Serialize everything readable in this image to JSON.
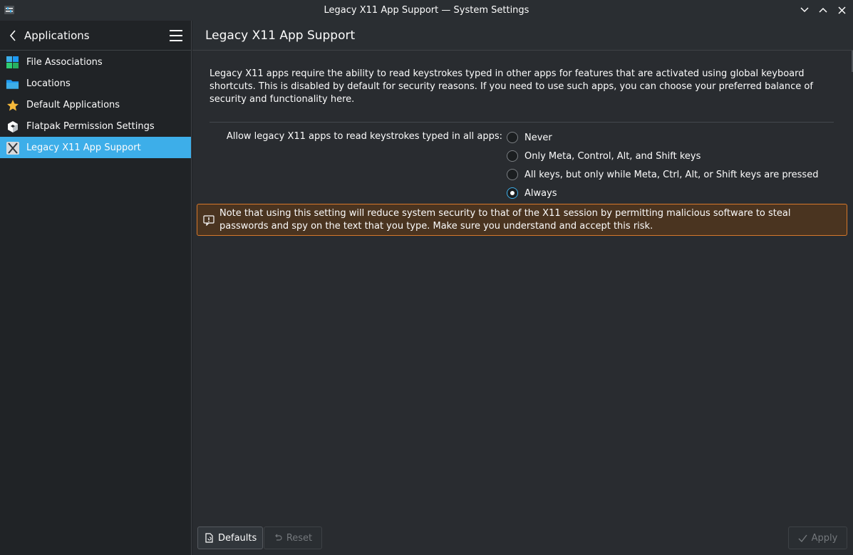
{
  "window": {
    "title": "Legacy X11 App Support — System Settings"
  },
  "sidebar": {
    "header": "Applications",
    "items": [
      {
        "label": "File Associations",
        "icon": "file-associations-icon"
      },
      {
        "label": "Locations",
        "icon": "folder-icon"
      },
      {
        "label": "Default Applications",
        "icon": "star-icon"
      },
      {
        "label": "Flatpak Permission Settings",
        "icon": "flatpak-icon"
      },
      {
        "label": "Legacy X11 App Support",
        "icon": "x11-icon",
        "active": true
      }
    ]
  },
  "main": {
    "title": "Legacy X11 App Support",
    "description": "Legacy X11 apps require the ability to read keystrokes typed in other apps for features that are activated using global keyboard shortcuts. This is disabled by default for security reasons. If you need to use such apps, you can choose your preferred balance of security and functionality here.",
    "option_label": "Allow legacy X11 apps to read keystrokes typed in all apps:",
    "options": [
      {
        "label": "Never",
        "checked": false
      },
      {
        "label": "Only Meta, Control, Alt, and Shift keys",
        "checked": false
      },
      {
        "label": "All keys, but only while Meta, Ctrl, Alt, or Shift keys are pressed",
        "checked": false
      },
      {
        "label": "Always",
        "checked": true
      }
    ],
    "warning": "Note that using this setting will reduce system security to that of the X11 session by permitting malicious software to steal passwords and spy on the text that you type. Make sure you understand and accept this risk."
  },
  "footer": {
    "defaults_label": "Defaults",
    "reset_label": "Reset",
    "apply_label": "Apply"
  },
  "colors": {
    "accent": "#3daee9",
    "warning_border": "#d6782b",
    "warning_bg": "#4a3420"
  }
}
